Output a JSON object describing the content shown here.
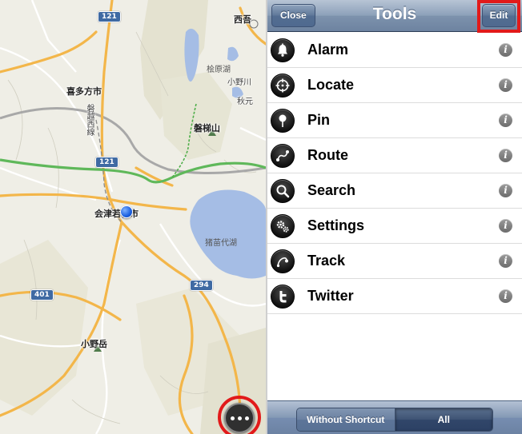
{
  "map": {
    "place_labels": {
      "kitakata": "喜多方市",
      "aizuwakamatsu": "会津若松市",
      "bandaisan": "磐梯山",
      "onodake": "小野岳",
      "nishiaizu": "西吾",
      "hibarako": "桧原湖",
      "onogawa": "小野川",
      "akimoto": "秋元",
      "inawashiroko": "猪苗代湖",
      "rail_line": "磐越西線"
    },
    "route_shields": [
      "121",
      "121",
      "401",
      "294"
    ],
    "more_button_label": "more-options"
  },
  "navbar": {
    "title": "Tools",
    "close_label": "Close",
    "edit_label": "Edit"
  },
  "tools": [
    {
      "label": "Alarm",
      "icon": "bell-icon"
    },
    {
      "label": "Locate",
      "icon": "crosshair-icon"
    },
    {
      "label": "Pin",
      "icon": "pin-icon"
    },
    {
      "label": "Route",
      "icon": "route-icon"
    },
    {
      "label": "Search",
      "icon": "magnifier-icon"
    },
    {
      "label": "Settings",
      "icon": "gears-icon"
    },
    {
      "label": "Track",
      "icon": "track-icon"
    },
    {
      "label": "Twitter",
      "icon": "twitter-icon"
    }
  ],
  "info_glyph": "i",
  "toolbar": {
    "segment_left": "Without Shortcut",
    "segment_right": "All",
    "selected": "All"
  },
  "colors": {
    "highlight": "#e21a1a",
    "navbar": "#7d92ad",
    "road_major": "#f3b64a",
    "road_green": "#5fb85a",
    "water": "#a5bde5"
  }
}
